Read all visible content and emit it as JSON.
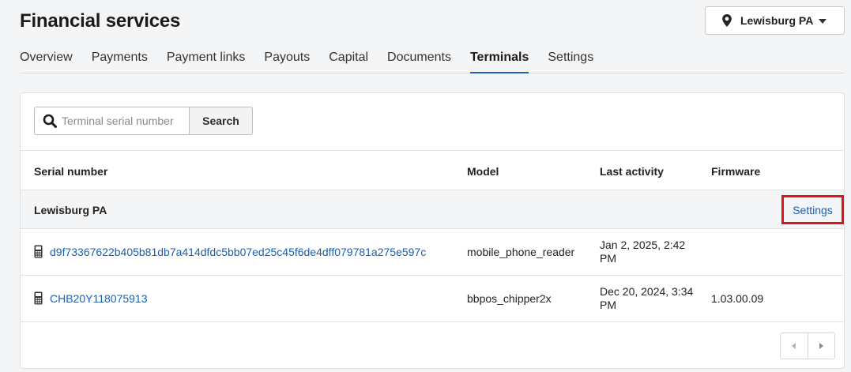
{
  "page": {
    "title": "Financial services"
  },
  "location_selector": {
    "label": "Lewisburg PA",
    "icon": "map-pin-icon"
  },
  "tabs": [
    {
      "label": "Overview",
      "active": false
    },
    {
      "label": "Payments",
      "active": false
    },
    {
      "label": "Payment links",
      "active": false
    },
    {
      "label": "Payouts",
      "active": false
    },
    {
      "label": "Capital",
      "active": false
    },
    {
      "label": "Documents",
      "active": false
    },
    {
      "label": "Terminals",
      "active": true
    },
    {
      "label": "Settings",
      "active": false
    }
  ],
  "search": {
    "placeholder": "Terminal serial number",
    "value": "",
    "button_label": "Search"
  },
  "table": {
    "columns": [
      "Serial number",
      "Model",
      "Last activity",
      "Firmware"
    ],
    "group": {
      "name": "Lewisburg PA",
      "settings_label": "Settings"
    },
    "rows": [
      {
        "serial": "d9f73367622b405b81db7a414dfdc5bb07ed25c45f6de4dff079781a275e597c",
        "model": "mobile_phone_reader",
        "last_activity": "Jan 2, 2025, 2:42 PM",
        "firmware": ""
      },
      {
        "serial": "CHB20Y118075913",
        "model": "bbpos_chipper2x",
        "last_activity": "Dec 20, 2024, 3:34 PM",
        "firmware": "1.03.00.09"
      }
    ]
  },
  "colors": {
    "link": "#1a5fb4",
    "highlight": "#e0131d",
    "active_tab_underline": "#1a5fb4"
  }
}
